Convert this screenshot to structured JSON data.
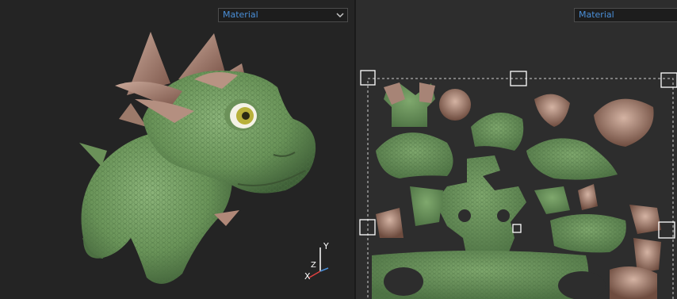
{
  "left_viewport": {
    "material_dropdown": {
      "value": "Material"
    },
    "axis_gizmo": {
      "x_label": "X",
      "y_label": "Y",
      "z_label": "Z"
    }
  },
  "right_viewport": {
    "material_dropdown": {
      "value": "Material"
    }
  },
  "colors": {
    "accent": "#4a8fd8",
    "viewport_bg": "#242424",
    "skin_green": "#6f9a60",
    "horn_brown": "#a07a6a",
    "gizmo_x": "#e04040",
    "gizmo_y": "#ffffff",
    "selection": "#ffffff"
  }
}
